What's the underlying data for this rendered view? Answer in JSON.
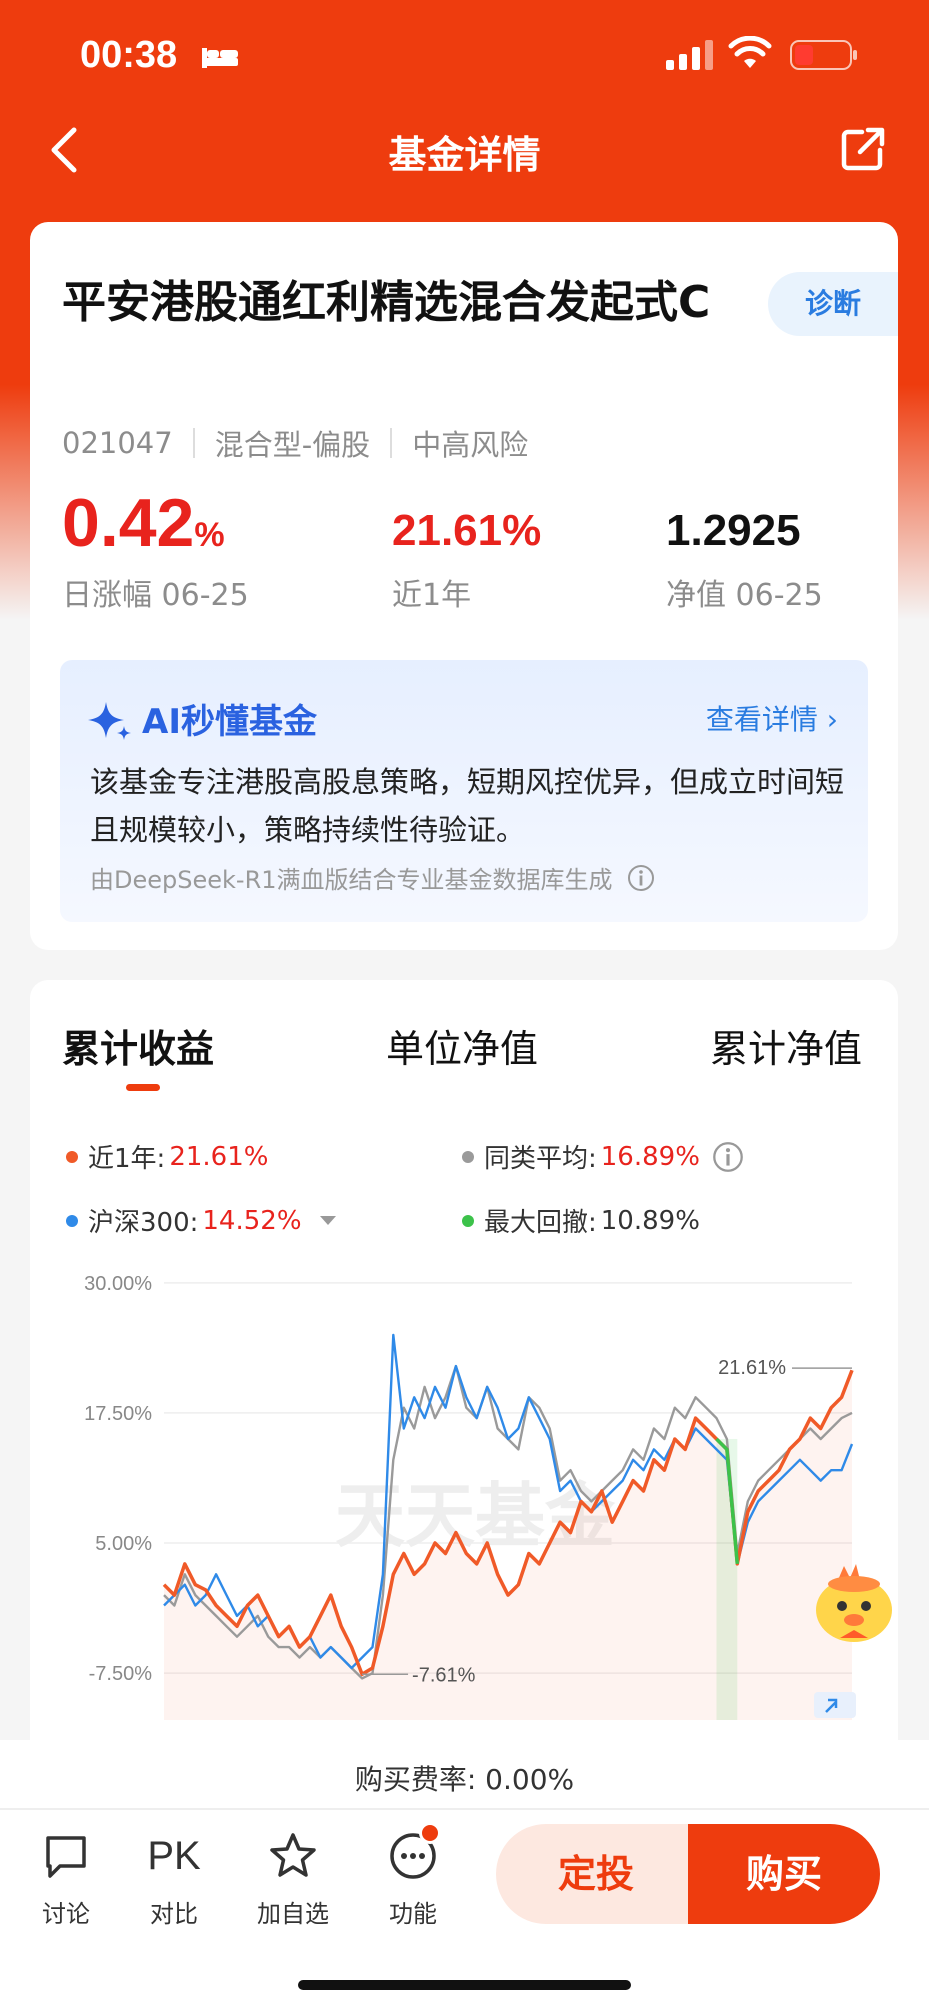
{
  "status_bar": {
    "time": "00:38"
  },
  "nav": {
    "title": "基金详情"
  },
  "fund": {
    "name": "平安港股通红利精选混合发起式C",
    "diagnose_label": "诊断",
    "code": "021047",
    "type": "混合型-偏股",
    "risk": "中高风险",
    "daily_change_value": "0.42",
    "daily_change_unit": "%",
    "daily_change_label": "日涨幅 06-25",
    "year_return_value": "21.61%",
    "year_return_label": "近1年",
    "nav_value": "1.2925",
    "nav_label": "净值 06-25"
  },
  "ai": {
    "title": "AI秒懂基金",
    "more_label": "查看详情",
    "summary": "该基金专注港股高股息策略，短期风控优异，但成立时间短且规模较小，策略持续性待验证。",
    "footnote": "由DeepSeek-R1满血版结合专业基金数据库生成"
  },
  "performance": {
    "tabs": [
      "累计收益",
      "单位净值",
      "累计净值"
    ],
    "legend": [
      {
        "label": "近1年:",
        "value": "21.61%",
        "color": "#f05a28",
        "value_color": "#e8231d"
      },
      {
        "label": "同类平均:",
        "value": "16.89%",
        "color": "#9a9a9a",
        "value_color": "#e8231d"
      },
      {
        "label": "沪深300:",
        "value": "14.52%",
        "color": "#2f8ae8",
        "value_color": "#e8231d"
      },
      {
        "label": "最大回撤:",
        "value": "10.89%",
        "color": "#3cc24a",
        "value_color": "#333333"
      }
    ]
  },
  "chart_data": {
    "type": "line",
    "y_ticks": [
      "30.00%",
      "17.50%",
      "5.00%",
      "-7.50%"
    ],
    "ylim": [
      -12,
      32
    ],
    "watermark": "天天基金",
    "annotations": {
      "max_label": "21.61%",
      "min_label": "-7.61%"
    },
    "series": [
      {
        "name": "近1年",
        "color": "#f05a28",
        "values": [
          1,
          0,
          3,
          1,
          0.5,
          -1,
          -2,
          -3,
          -1,
          0,
          -2,
          -4,
          -3,
          -5,
          -4,
          -2,
          0,
          -3,
          -5,
          -7.61,
          -7,
          -3,
          2,
          4,
          2,
          3,
          5,
          4,
          6,
          4,
          3,
          5,
          2,
          0,
          1,
          4,
          3,
          5,
          7,
          6,
          9,
          8,
          10,
          7,
          9,
          11,
          10,
          13,
          12,
          15,
          14,
          17,
          16,
          15,
          14,
          3,
          8,
          10,
          11,
          12,
          14,
          15,
          17,
          16,
          18,
          19,
          21.61
        ]
      },
      {
        "name": "同类平均",
        "color": "#9a9a9a",
        "values": [
          0,
          -1,
          2,
          0,
          -1,
          -2,
          -3,
          -4,
          -3,
          -2,
          -4,
          -5,
          -5,
          -6,
          -5,
          -6,
          -5,
          -6,
          -7,
          -8,
          -7.5,
          0,
          13,
          18,
          16,
          20,
          17,
          19,
          22,
          18,
          17,
          20,
          16,
          15,
          14,
          19,
          18,
          16,
          11,
          12,
          10,
          9,
          10,
          11,
          12,
          14,
          13,
          16,
          15,
          18,
          17,
          19,
          18,
          17,
          15,
          4,
          9,
          11,
          12,
          13,
          14,
          15,
          16,
          15,
          16,
          17,
          17.5
        ]
      },
      {
        "name": "沪深300",
        "color": "#2f8ae8",
        "values": [
          -1,
          0,
          1,
          -1,
          0,
          2,
          0,
          -2,
          -1,
          -3,
          -2,
          -4,
          -3,
          -5,
          -4,
          -6,
          -5,
          -6,
          -7,
          -6,
          -5,
          2,
          25,
          16,
          19,
          17,
          20,
          18,
          22,
          19,
          17,
          20,
          18,
          15,
          16,
          19,
          17,
          15,
          10,
          11,
          9,
          8,
          9,
          10,
          11,
          13,
          12,
          14,
          13,
          15,
          14,
          16,
          15,
          14,
          13,
          3,
          7,
          9,
          10,
          11,
          12,
          13,
          12,
          11,
          12,
          12,
          14.52
        ]
      }
    ]
  },
  "purchase": {
    "fee_label": "购买费率: 0.00%"
  },
  "toolbar": {
    "discuss": "讨论",
    "pk_glyph": "PK",
    "compare": "对比",
    "watchlist": "加自选",
    "functions": "功能",
    "sip_button": "定投",
    "buy_button": "购买"
  },
  "colors": {
    "brand": "#ee3c0e",
    "rise": "#e8231d",
    "ai_blue": "#2a62e0"
  }
}
